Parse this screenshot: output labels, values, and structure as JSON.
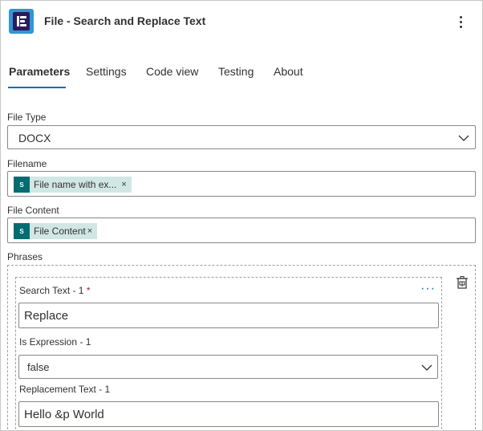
{
  "header": {
    "title": "File - Search and Replace Text",
    "more_icon": "more-vertical-icon"
  },
  "tabs": [
    {
      "label": "Parameters",
      "active": true
    },
    {
      "label": "Settings",
      "active": false
    },
    {
      "label": "Code view",
      "active": false
    },
    {
      "label": "Testing",
      "active": false
    },
    {
      "label": "About",
      "active": false
    }
  ],
  "form": {
    "file_type": {
      "label": "File Type",
      "value": "DOCX"
    },
    "filename": {
      "label": "Filename",
      "token": "File name with ex...",
      "token_icon": "sharepoint-icon",
      "token_icon_text": "S"
    },
    "file_content": {
      "label": "File Content",
      "token": "File Content",
      "token_icon": "sharepoint-icon",
      "token_icon_text": "S"
    },
    "phrases": {
      "label": "Phrases",
      "items": [
        {
          "search_label": "Search Text - 1",
          "required_mark": "*",
          "search_value": "Replace",
          "is_expression_label": "Is Expression - 1",
          "is_expression_value": "false",
          "replacement_label": "Replacement Text - 1",
          "replacement_value": "Hello &p World"
        }
      ]
    }
  },
  "colors": {
    "accent": "#0f6cbd",
    "token_bg": "#d1e7e4",
    "sharepoint": "#036c70",
    "required": "#a4262c"
  }
}
